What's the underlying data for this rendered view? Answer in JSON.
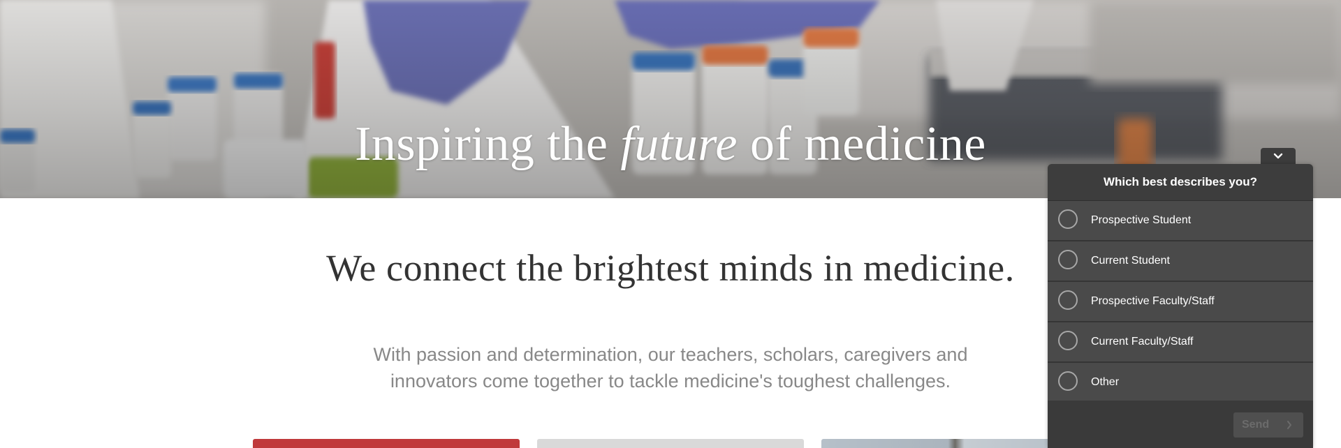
{
  "hero": {
    "title_before": "Inspiring the ",
    "title_emphasis": "future",
    "title_after": " of medicine"
  },
  "main": {
    "headline": "We connect the brightest minds in medicine.",
    "subtext": "With passion and determination, our teachers, scholars, caregivers and innovators come together to tackle medicine's toughest challenges."
  },
  "survey": {
    "toggle_icon": "chevron-down-icon",
    "question": "Which best describes you?",
    "options": [
      {
        "label": "Prospective Student"
      },
      {
        "label": "Current Student"
      },
      {
        "label": "Prospective Faculty/Staff"
      },
      {
        "label": "Current Faculty/Staff"
      },
      {
        "label": "Other"
      }
    ],
    "send_label": "Send",
    "send_icon": "chevron-right-icon"
  },
  "colors": {
    "hero_text": "#ffffff",
    "headline": "#333333",
    "subtext": "#888888",
    "survey_bg": "#3d3d3d",
    "survey_option_bg": "#4a4a4a",
    "card_red": "#c0393b",
    "card_gray": "#d9d9d9"
  }
}
